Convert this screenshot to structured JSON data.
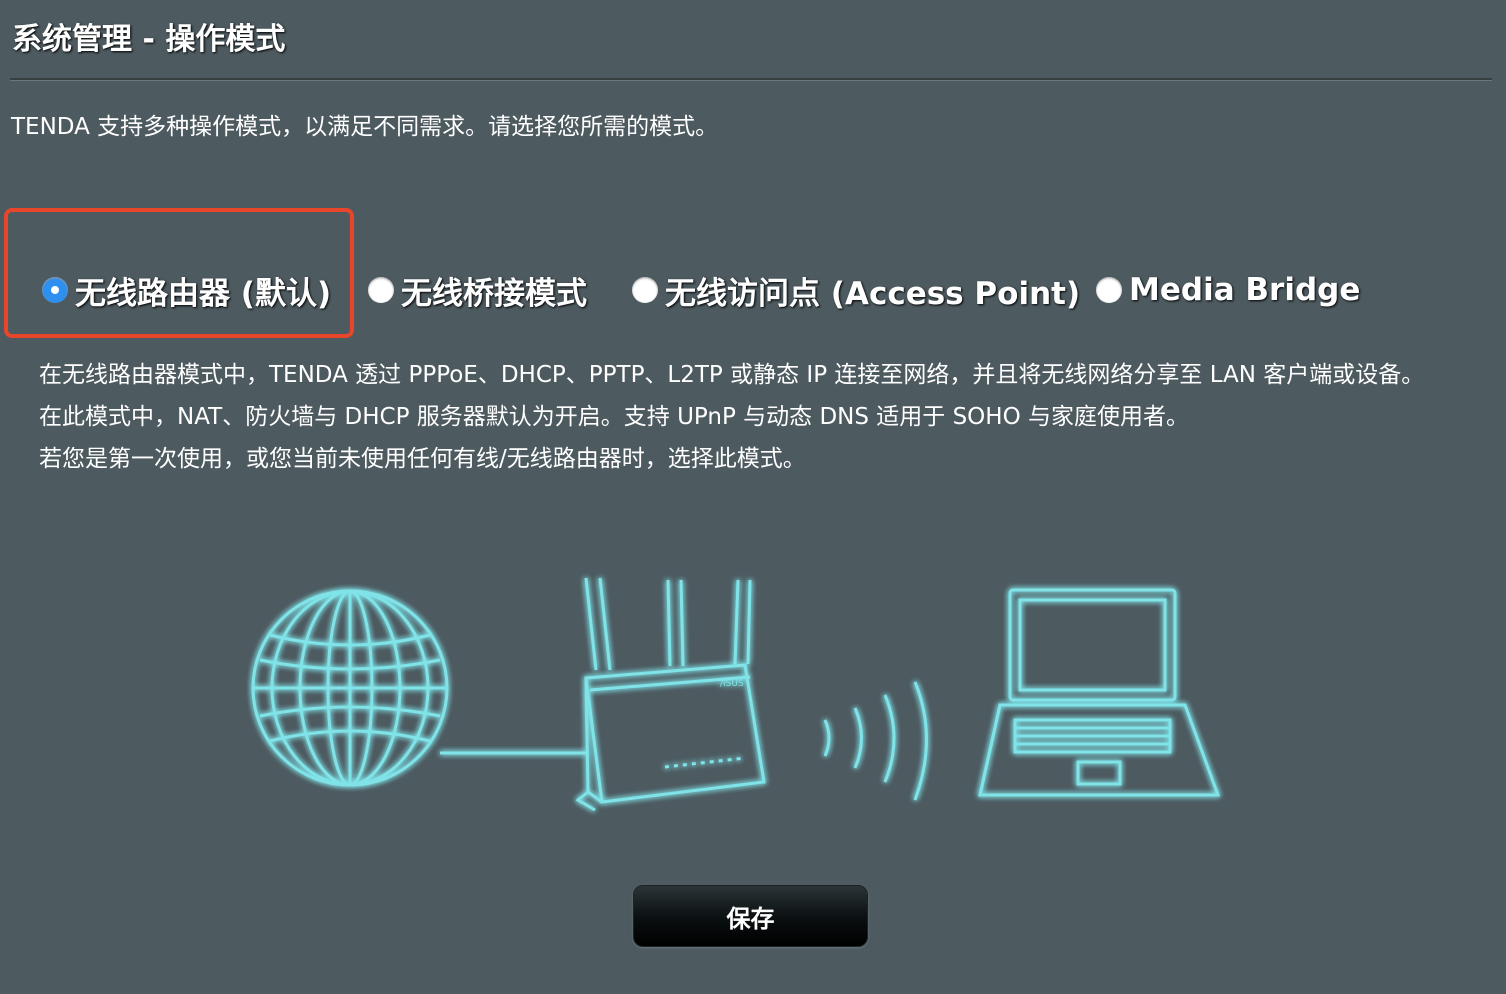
{
  "header": {
    "title": "系统管理 - 操作模式"
  },
  "intro": {
    "text": "TENDA 支持多种操作模式，以满足不同需求。请选择您所需的模式。"
  },
  "modes": [
    {
      "label": "无线路由器 (默认)",
      "checked": true
    },
    {
      "label": "无线桥接模式",
      "checked": false
    },
    {
      "label": "无线访问点 (Access Point)",
      "checked": false
    },
    {
      "label": "Media Bridge",
      "checked": false
    }
  ],
  "description": {
    "line1": "在无线路由器模式中，TENDA 透过 PPPoE、DHCP、PPTP、L2TP 或静态 IP 连接至网络，并且将无线网络分享至 LAN 客户端或设备。",
    "line2": "在此模式中，NAT、防火墙与 DHCP 服务器默认为开启。支持 UPnP 与动态 DNS 适用于 SOHO 与家庭使用者。",
    "line3": "若您是第一次使用，或您当前未使用任何有线/无线路由器时，选择此模式。"
  },
  "illustration": {
    "icons": [
      "globe-icon",
      "router-icon",
      "wifi-waves-icon",
      "laptop-icon"
    ],
    "logo": "/ISUS",
    "line_color": "#7fe3e8",
    "glow_color": "#39c6d0"
  },
  "actions": {
    "save_label": "保存"
  },
  "colors": {
    "background": "#4d5a60",
    "highlight": "#e8462b",
    "radio_selected": "#2d8ff0"
  }
}
